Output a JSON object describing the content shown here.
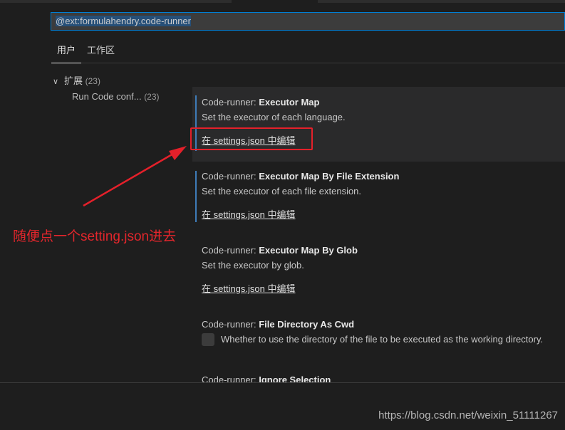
{
  "search": {
    "value": "@ext:formulahendry.code-runner"
  },
  "tabs": [
    {
      "label": "用户"
    },
    {
      "label": "工作区"
    }
  ],
  "toc": {
    "group_label": "扩展",
    "group_count": "(23)",
    "item_label": "Run Code conf...",
    "item_count": "(23)"
  },
  "settings": [
    {
      "category": "Code-runner: ",
      "name": "Executor Map",
      "description": "Set the executor of each language.",
      "link": "在 settings.json 中编辑"
    },
    {
      "category": "Code-runner: ",
      "name": "Executor Map By File Extension",
      "description": "Set the executor of each file extension.",
      "link": "在 settings.json 中编辑"
    },
    {
      "category": "Code-runner: ",
      "name": "Executor Map By Glob",
      "description": "Set the executor by glob.",
      "link": "在 settings.json 中编辑"
    },
    {
      "category": "Code-runner: ",
      "name": "File Directory As Cwd",
      "description": "Whether to use the directory of the file to be executed as the working directory.",
      "checked": false
    },
    {
      "category": "Code-runner: ",
      "name": "Ignore Selection"
    }
  ],
  "annotation": {
    "text": "随便点一个setting.json进去",
    "color": "#e3262c"
  },
  "watermark": "https://blog.csdn.net/weixin_51111267",
  "colors": {
    "accent": "#007fd4",
    "background": "#1e1e1e",
    "modified_bar": "#3e7cb8"
  }
}
